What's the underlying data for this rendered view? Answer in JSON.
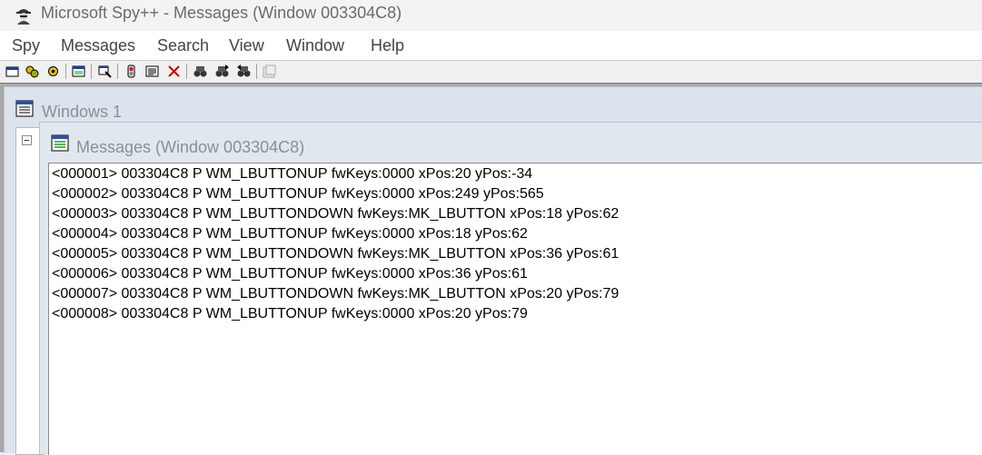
{
  "window": {
    "title": "Microsoft Spy++ - Messages (Window 003304C8)",
    "icon": "spy-app-icon"
  },
  "menu": {
    "items": [
      {
        "label": "Spy"
      },
      {
        "label": "Messages"
      },
      {
        "label": "Search"
      },
      {
        "label": "View"
      },
      {
        "label": "Window"
      },
      {
        "label": "Help"
      }
    ]
  },
  "toolbar": {
    "buttons": [
      {
        "icon": "windows-icon"
      },
      {
        "icon": "processes-icon"
      },
      {
        "icon": "threads-icon"
      },
      {
        "icon": "log-messages-icon"
      },
      {
        "icon": "message-options-icon"
      },
      {
        "icon": "start-stop-logging-icon"
      },
      {
        "icon": "clear-log-icon"
      },
      {
        "icon": "delete-icon"
      },
      {
        "icon": "find-window-icon"
      },
      {
        "icon": "find-next-icon"
      },
      {
        "icon": "find-previous-icon"
      },
      {
        "icon": "properties-icon"
      }
    ]
  },
  "windows_pane": {
    "title": "Windows 1"
  },
  "messages_pane": {
    "title": "Messages (Window 003304C8)",
    "lines": [
      "<000001> 003304C8 P WM_LBUTTONUP fwKeys:0000 xPos:20 yPos:-34",
      "<000002> 003304C8 P WM_LBUTTONUP fwKeys:0000 xPos:249 yPos:565",
      "<000003> 003304C8 P WM_LBUTTONDOWN fwKeys:MK_LBUTTON xPos:18 yPos:62",
      "<000004> 003304C8 P WM_LBUTTONUP fwKeys:0000 xPos:18 yPos:62",
      "<000005> 003304C8 P WM_LBUTTONDOWN fwKeys:MK_LBUTTON xPos:36 yPos:61",
      "<000006> 003304C8 P WM_LBUTTONUP fwKeys:0000 xPos:36 yPos:61",
      "<000007> 003304C8 P WM_LBUTTONDOWN fwKeys:MK_LBUTTON xPos:20 yPos:79",
      "<000008> 003304C8 P WM_LBUTTONUP fwKeys:0000 xPos:20 yPos:79"
    ]
  }
}
